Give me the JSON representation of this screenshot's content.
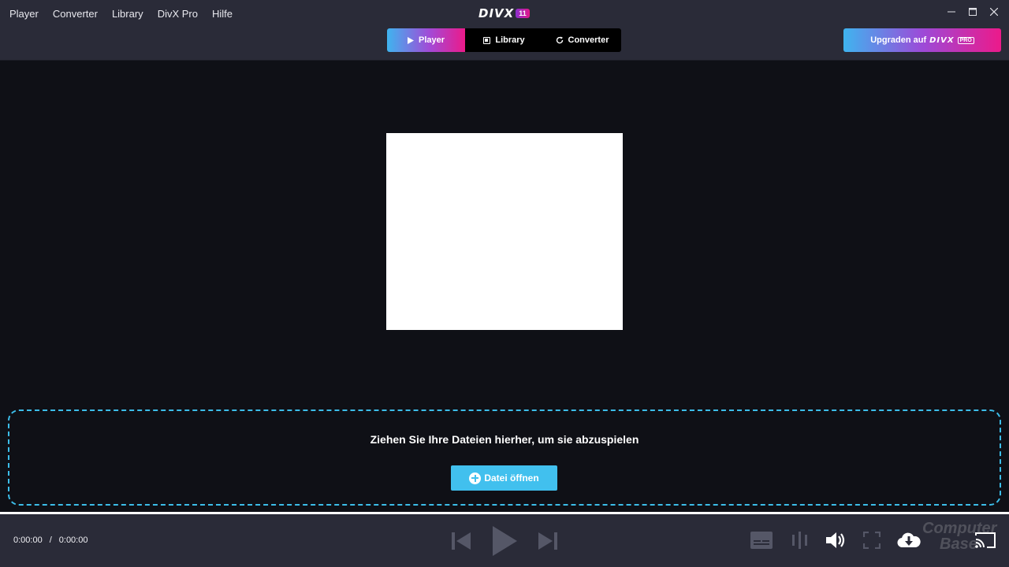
{
  "menu": {
    "items": [
      "Player",
      "Converter",
      "Library",
      "DivX Pro",
      "Hilfe"
    ]
  },
  "logo": {
    "text": "DIVX",
    "badge": "11"
  },
  "window_controls": {
    "minimize_icon": "minimize-icon",
    "maximize_icon": "maximize-icon",
    "close_icon": "close-icon"
  },
  "tabs": [
    {
      "label": "Player",
      "icon": "play-icon",
      "active": true
    },
    {
      "label": "Library",
      "icon": "library-icon",
      "active": false
    },
    {
      "label": "Converter",
      "icon": "refresh-icon",
      "active": false
    }
  ],
  "upgrade": {
    "label": "Upgraden auf",
    "brand": "DIVX",
    "pro": "PRO"
  },
  "dropzone": {
    "text": "Ziehen Sie Ihre Dateien hierher, um sie abzuspielen",
    "button_label": "Datei öffnen"
  },
  "playback": {
    "current_time": "0:00:00",
    "separator": "/",
    "total_time": "0:00:00",
    "progress": 0
  },
  "colors": {
    "accent_blue": "#41c0ee",
    "accent_pink": "#ec1a8a",
    "titlebar_bg": "#2a2b38",
    "video_bg": "#0f1016"
  },
  "watermark": {
    "line1": "Computer",
    "line2": "Base"
  }
}
